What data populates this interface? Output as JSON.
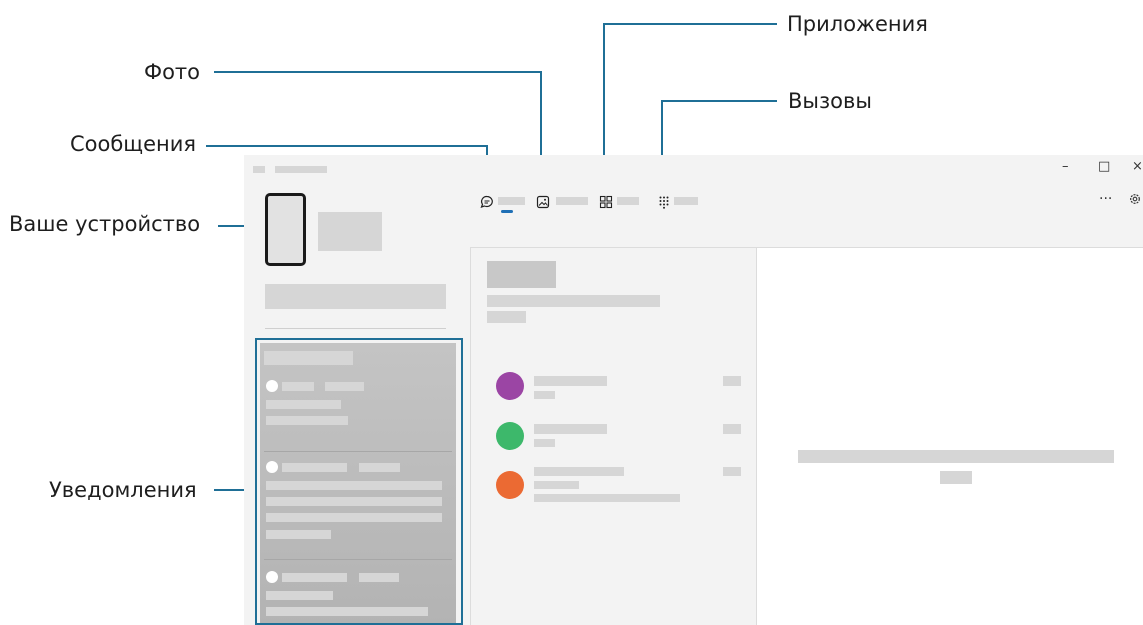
{
  "callouts": {
    "photos": "Фото",
    "messages": "Сообщения",
    "your_device": "Ваше устройство",
    "notifications": "Уведомления",
    "apps": "Приложения",
    "calls": "Вызовы"
  },
  "window_controls": {
    "minimize": "–",
    "maximize": "□",
    "close": "×",
    "more": "···"
  },
  "colors": {
    "callout_line": "#1f6f96",
    "avatar_1": "#9b45a4",
    "avatar_2": "#3db86b",
    "avatar_3": "#eb6a33",
    "tab_indicator": "#1f6fb5"
  },
  "icons": {
    "messages_tab": "chat-bubble-icon",
    "photos_tab": "image-icon",
    "apps_tab": "grid-icon",
    "calls_tab": "dialpad-icon",
    "settings": "gear-icon"
  }
}
